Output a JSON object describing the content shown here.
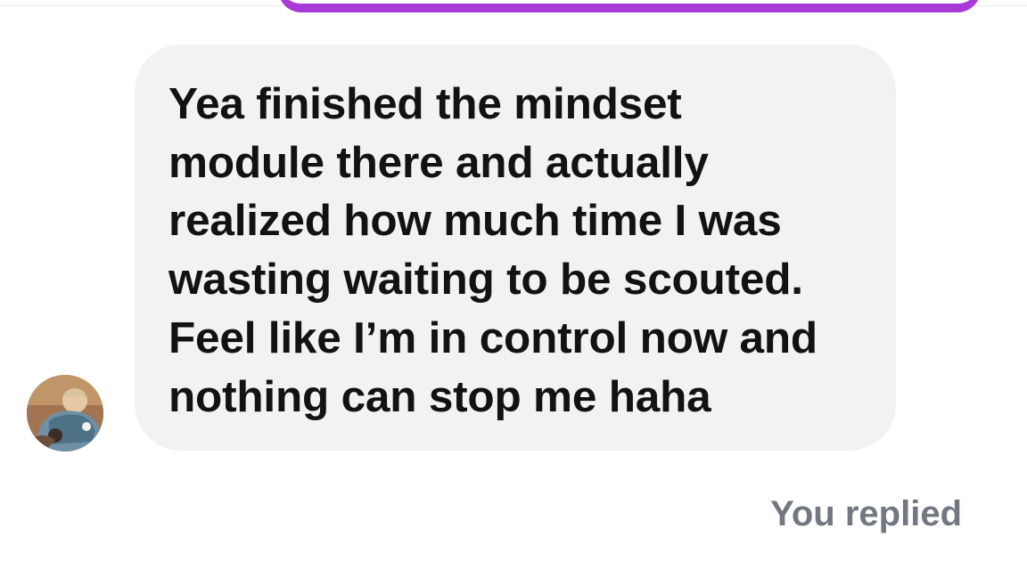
{
  "conversation": {
    "received_message": {
      "text": "Yea finished the mindset\nmodule there and actually\nrealized how much time I was\nwasting waiting to be scouted.\nFeel like I’m in control now and\nnothing can stop me haha"
    },
    "reply_status": "You replied"
  },
  "colors": {
    "background": "#ffffff",
    "received_bubble": "#f2f2f4",
    "sent_bubble_accent": "#a83bd6",
    "message_text": "#121212",
    "status_text": "#727782"
  },
  "icons": {
    "avatar": "profile-photo"
  }
}
